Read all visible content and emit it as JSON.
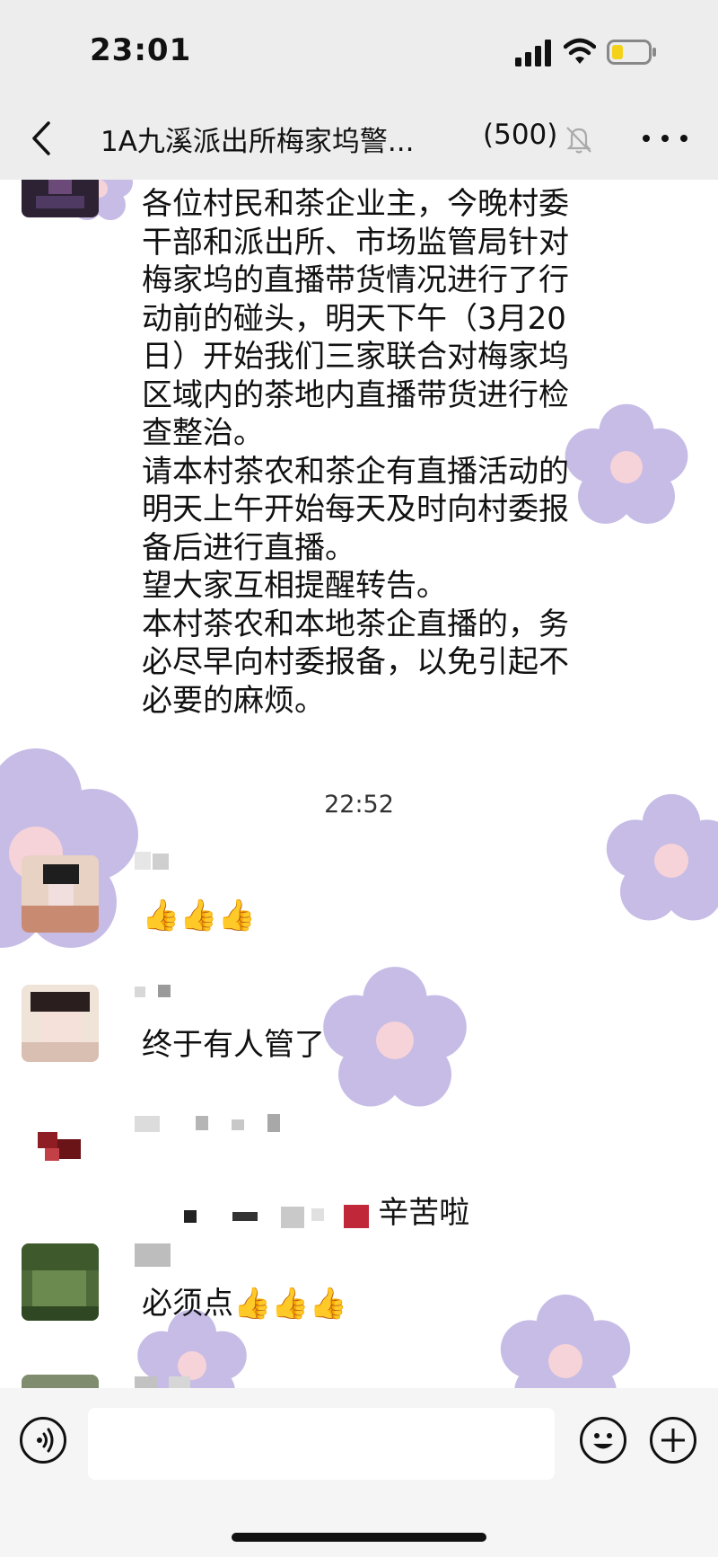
{
  "status_bar": {
    "time": "23:01"
  },
  "header": {
    "title": "1A九溪派出所梅家坞警...",
    "member_count": "(500)"
  },
  "messages": [
    {
      "type": "text",
      "text": "各位村民和茶企业主，今晚村委\n干部和派出所、市场监管局针对\n梅家坞的直播带货情况进行了行\n动前的碰头，明天下午（3月20\n日）开始我们三家联合对梅家坞\n区域内的茶地内直播带货进行检\n查整治。\n请本村茶农和茶企有直播活动的\n明天上午开始每天及时向村委报\n备后进行直播。\n望大家互相提醒转告。\n本村茶农和本地茶企直播的，务\n必尽早向村委报备，以免引起不\n必要的麻烦。"
    },
    {
      "type": "timestamp",
      "text": "22:52"
    },
    {
      "type": "text",
      "text": "👍👍👍"
    },
    {
      "type": "text",
      "text": "终于有人管了"
    },
    {
      "type": "text",
      "text": "辛苦啦"
    },
    {
      "type": "text",
      "text": "必须点👍👍👍"
    }
  ],
  "icons": {
    "back": "chevron-left-icon",
    "mute": "bell-slash-icon",
    "more": "more-dots-icon",
    "voice": "voice-icon",
    "emoji": "emoji-icon",
    "plus": "plus-icon"
  },
  "colors": {
    "wallpaper_flower": "#c7bce6",
    "flower_center": "#f6d3d8",
    "topbar": "#ededed"
  }
}
